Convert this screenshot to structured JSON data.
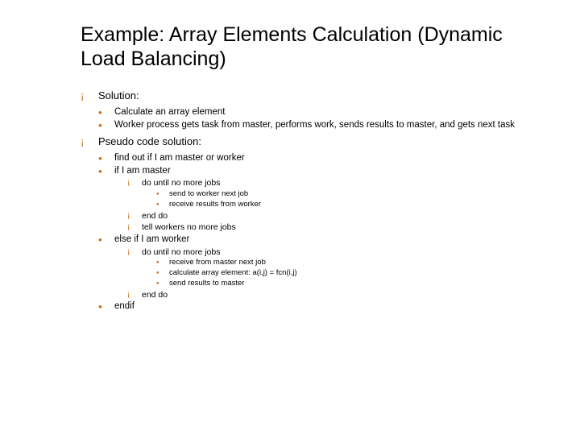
{
  "title": "Example: Array Elements Calculation (Dynamic Load Balancing)",
  "s1": {
    "h": "Solution:",
    "i1": "Calculate an array element",
    "i2": "Worker process gets task from master, performs work, sends results to master, and gets next task"
  },
  "s2": {
    "h": "Pseudo code solution:",
    "i1": "find out if I am master or worker",
    "i2": "if I am master",
    "i2a": "do until no more jobs",
    "i2a1": "send to worker next job",
    "i2a2": "receive results from worker",
    "i2b": "end do",
    "i2c": "tell workers no more jobs",
    "i3": "else if I am worker",
    "i3a": "do until no more jobs",
    "i3a1": "receive from master next job",
    "i3a2": "calculate array element: a(i,j) = fcn(i,j)",
    "i3a3": "send results to master",
    "i3b": "end do",
    "i4": "endif"
  }
}
